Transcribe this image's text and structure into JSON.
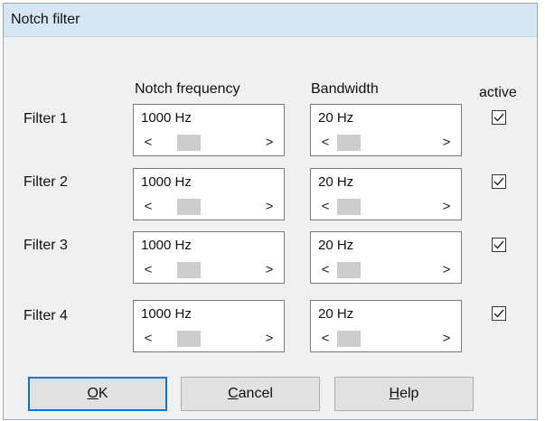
{
  "window": {
    "title": "Notch filter"
  },
  "columns": {
    "frequency": "Notch frequency",
    "bandwidth": "Bandwidth",
    "active": "active"
  },
  "filters": [
    {
      "label": "Filter 1",
      "frequency": "1000 Hz",
      "bandwidth": "20 Hz",
      "active": true
    },
    {
      "label": "Filter 2",
      "frequency": "1000 Hz",
      "bandwidth": "20 Hz",
      "active": true
    },
    {
      "label": "Filter 3",
      "frequency": "1000 Hz",
      "bandwidth": "20 Hz",
      "active": true
    },
    {
      "label": "Filter 4",
      "frequency": "1000 Hz",
      "bandwidth": "20 Hz",
      "active": true
    }
  ],
  "scroll_arrows": {
    "left": "<",
    "right": ">"
  },
  "buttons": {
    "ok": {
      "mnemonic": "O",
      "rest": "K"
    },
    "cancel": {
      "mnemonic": "C",
      "rest": "ancel"
    },
    "help": {
      "mnemonic": "H",
      "rest": "elp"
    }
  },
  "icons": {
    "checkbox": "checkmark-icon"
  }
}
